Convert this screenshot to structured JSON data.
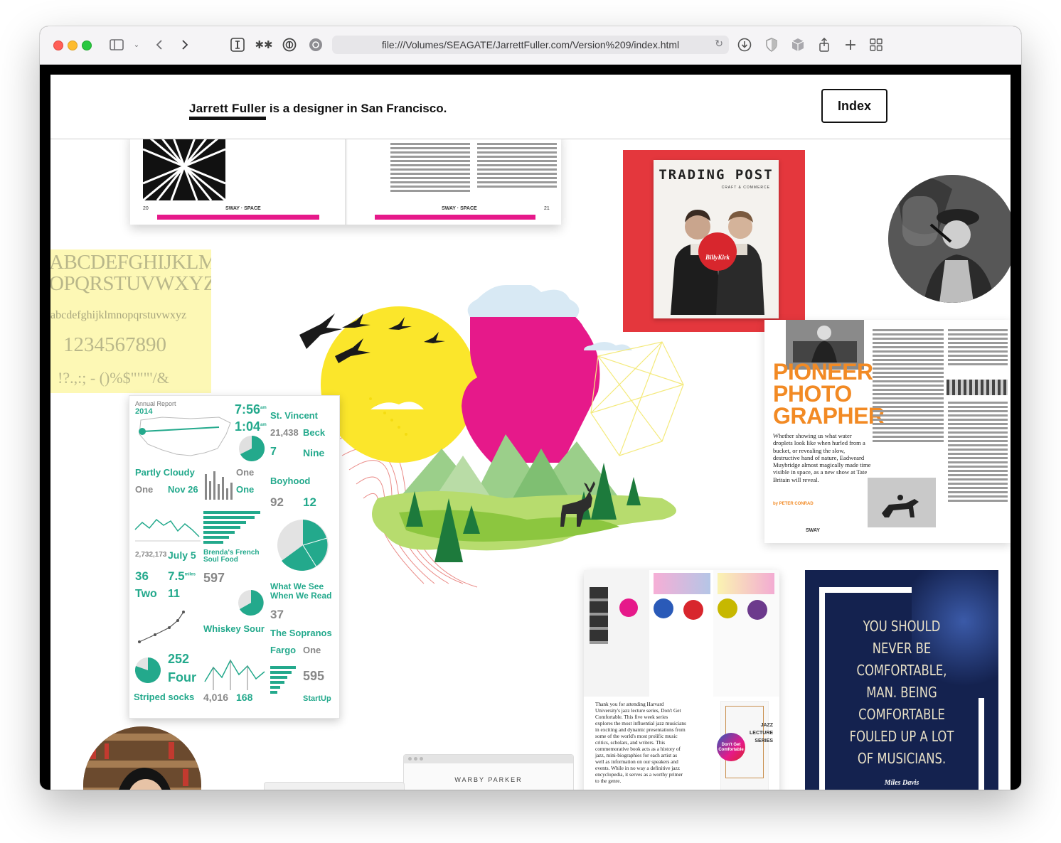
{
  "browser": {
    "url": "file:///Volumes/SEAGATE/JarrettFuller.com/Version%209/index.html"
  },
  "site": {
    "name": "Jarrett Fuller",
    "tagline_rest": "is a designer in San Francisco.",
    "index_label": "Index"
  },
  "tiles": {
    "magazine_spread": {
      "page_left": "20",
      "page_right": "21",
      "folio_left": "SWAY · SPACE",
      "folio_right": "SWAY · SPACE"
    },
    "type_specimen": {
      "line1": "ABCDEFGHIJKLMN",
      "line2": "OPQRSTUVWXYZ",
      "line3": "abcdefghijklmnopqrstuvwxyz",
      "line4": "1234567890",
      "line5": "!?.,:; - ()%$\"\"\"'/&"
    },
    "trading_post": {
      "title": "TRADING POST",
      "subtitle": "CRAFT & COMMERCE",
      "badge": "BillyKirk"
    },
    "annual_report": {
      "title": "Annual Report",
      "year": "2014",
      "items": [
        {
          "value": "7:56",
          "unit": "am"
        },
        {
          "value": "1:04",
          "unit": "am"
        },
        {
          "value": "St. Vincent"
        },
        {
          "value": "21,438"
        },
        {
          "value": "Beck"
        },
        {
          "value": "7"
        },
        {
          "value": "Nine"
        },
        {
          "value": "Partly Cloudy"
        },
        {
          "value": "One"
        },
        {
          "value": "Nov 26"
        },
        {
          "value": "One"
        },
        {
          "value": "One"
        },
        {
          "value": "Boyhood"
        },
        {
          "value": "92"
        },
        {
          "value": "12"
        },
        {
          "value": "2,732,173"
        },
        {
          "value": "July 5"
        },
        {
          "value": "Brenda's French Soul Food"
        },
        {
          "value": "36"
        },
        {
          "value": "7.5",
          "unit": "miles"
        },
        {
          "value": "597"
        },
        {
          "value": "What We See When We Read"
        },
        {
          "value": "Two"
        },
        {
          "value": "11"
        },
        {
          "value": "37"
        },
        {
          "value": "Whiskey Sour"
        },
        {
          "value": "The Sopranos"
        },
        {
          "value": "252"
        },
        {
          "value": "Fargo"
        },
        {
          "value": "One"
        },
        {
          "value": "Four"
        },
        {
          "value": "595"
        },
        {
          "value": "Striped socks"
        },
        {
          "value": "4,016"
        },
        {
          "value": "168"
        },
        {
          "value": "StartUp"
        }
      ]
    },
    "pioneer": {
      "headline1": "PIONEER",
      "headline2": "PHOTO",
      "headline3": "GRAPHER",
      "dek": "Whether showing us what water droplets look like when hurled from a bucket, or revealing the slow, destructive hand of nature, Eadweard Muybridge almost magically made time visible in space, as a new show at Tate Britain will reveal.",
      "byline": "by PETER CONRAD",
      "folio": "SWAY"
    },
    "jazz_poster": {
      "quote_l1": "YOU SHOULD",
      "quote_l2": "NEVER BE",
      "quote_l3": "COMFORTABLE,",
      "quote_l4": "MAN. BEING",
      "quote_l5": "COMFORTABLE",
      "quote_l6": "FOULED UP A LOT",
      "quote_l7": "OF MUSICIANS.",
      "attribution": "Miles Davis"
    },
    "jazz_booklet": {
      "body": "Thank you for attending Harvard University's jazz lecture series, Don't Get Comfortable. This five week series explores the most influential jazz musicians in exciting and dynamic presentations from some of the world's most prolific music critics, scholars, and writers. This commemorative book acts as a history of jazz, mini-biographies for each artist as well as information on our speakers and events. While in no way a definitive jazz encyclopedia, it serves as a worthy primer to the genre.",
      "series_l1": "JAZZ",
      "series_l2": "LECTURE",
      "series_l3": "SERIES",
      "badge": "Don't Get Comfortable"
    },
    "warby": {
      "title": "WARBY PARKER"
    }
  },
  "colors": {
    "magenta": "#e6198a",
    "yellow": "#fbe62b",
    "green": "#7bc142",
    "teal": "#23a98c",
    "orange": "#f28a24",
    "red": "#e8373d",
    "navy": "#14224f"
  }
}
